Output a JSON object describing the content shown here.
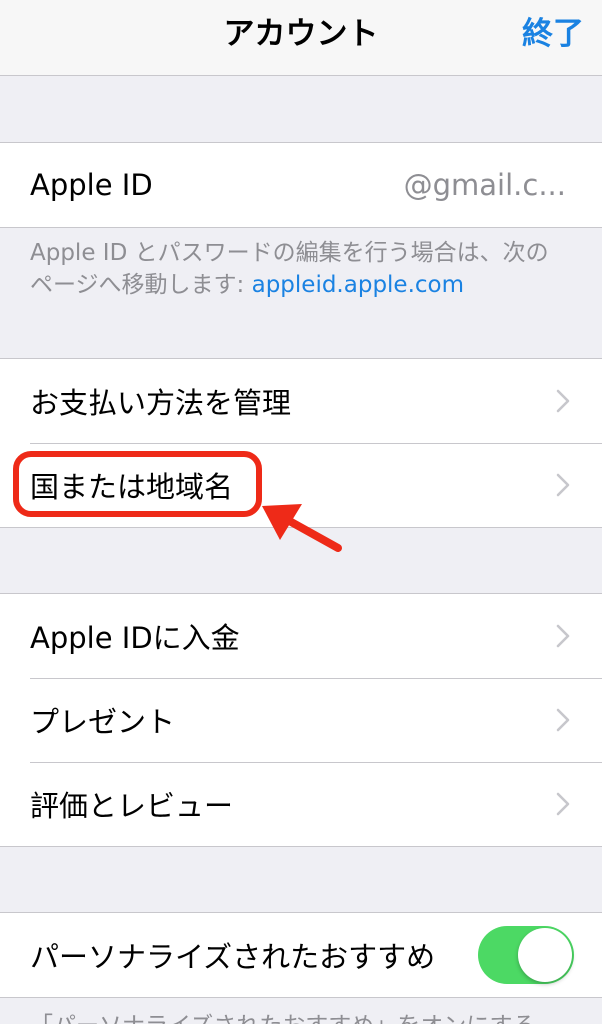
{
  "navbar": {
    "title": "アカウント",
    "done_label": "終了"
  },
  "apple_id_group": {
    "label": "Apple ID",
    "value": "@gmail.c..."
  },
  "apple_id_note": {
    "text": "Apple ID とパスワードの編集を行う場合は、次のページへ移動します: ",
    "link": "appleid.apple.com"
  },
  "payment_group": {
    "items": [
      {
        "label": "お支払い方法を管理"
      },
      {
        "label": "国または地域名"
      }
    ]
  },
  "store_group": {
    "items": [
      {
        "label": "Apple IDに入金"
      },
      {
        "label": "プレゼント"
      },
      {
        "label": "評価とレビュー"
      }
    ]
  },
  "personalize_group": {
    "label": "パーソナライズされたおすすめ",
    "toggle_on": true
  },
  "personalize_note": {
    "text": "「パーソナライズされたおすすめ」をオンにする"
  },
  "colors": {
    "accent": "#1a82e2",
    "toggle_on": "#4cd964",
    "annotation": "#ee2a18"
  }
}
